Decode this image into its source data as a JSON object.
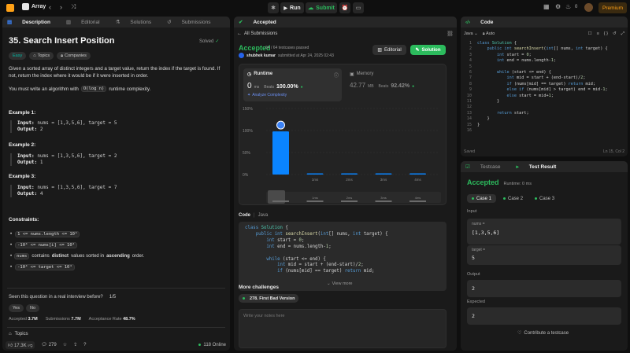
{
  "topbar": {
    "problem_list_label": "Array",
    "run_label": "Run",
    "submit_label": "Submit",
    "premium_label": "Premium",
    "notif_count": "0"
  },
  "left": {
    "tabs": [
      "Description",
      "Editorial",
      "Solutions",
      "Submissions"
    ],
    "title": "35. Search Insert Position",
    "solved_label": "Solved",
    "difficulty": "Easy",
    "topics_label": "Topics",
    "companies_label": "Companies",
    "desc_1": "Given a sorted array of distinct integers and a target value, return the index if the target is found. If not, return the index where it would be if it were inserted in order.",
    "desc_2_a": "You must write an algorithm with",
    "desc_2_code": "O(log n)",
    "desc_2_b": "runtime complexity.",
    "examples": [
      {
        "title": "Example 1:",
        "input": "nums = [1,3,5,6], target = 5",
        "output": "2"
      },
      {
        "title": "Example 2:",
        "input": "nums = [1,3,5,6], target = 2",
        "output": "1"
      },
      {
        "title": "Example 3:",
        "input": "nums = [1,3,5,6], target = 7",
        "output": "4"
      }
    ],
    "input_label": "Input:",
    "output_label": "Output:",
    "constraints_title": "Constraints:",
    "constraints": [
      "1 <= nums.length <= 10⁴",
      "-10⁴ <= nums[i] <= 10⁴",
      "",
      "-10⁴ <= target <= 10⁴"
    ],
    "constraint3_code": "nums",
    "constraint3_a": "contains",
    "constraint3_b": "distinct",
    "constraint3_c": "values sorted in",
    "constraint3_d": "ascending",
    "constraint3_e": "order.",
    "interview_q": "Seen this question in a real interview before?",
    "interview_pages": "1/5",
    "yes": "Yes",
    "no": "No",
    "accepted_label": "Accepted",
    "accepted_val": "3.7M",
    "submissions_label": "Submissions",
    "submissions_val": "7.7M",
    "rate_label": "Acceptance Rate",
    "rate_val": "48.7%",
    "topics_footer": "Topics",
    "likes": "17.3K",
    "comments": "279",
    "online": "118 Online"
  },
  "middle": {
    "tab": "Accepted",
    "all_submissions": "All Submissions",
    "status": "Accepted",
    "testcases": "64 / 64 testcases passed",
    "user": "shubhek kumar",
    "submitted_at": "submitted at Apr 24, 2025 02:43",
    "editorial_btn": "Editorial",
    "solution_btn": "Solution",
    "runtime_label": "Runtime",
    "runtime_val": "0",
    "runtime_unit": "ms",
    "beats_label": "Beats",
    "runtime_beats": "100.00%",
    "analyze": "Analyze Complexity",
    "memory_label": "Memory",
    "memory_val": "42.77",
    "memory_unit": "MB",
    "memory_beats": "92.42%",
    "code_label": "Code",
    "lang": "Java",
    "view_more": "View more",
    "more_challenges": "More challenges",
    "challenge": "278. First Bad Version",
    "notes_placeholder": "Write your notes here"
  },
  "chart_data": {
    "type": "bar",
    "categories": [
      "",
      "1ms",
      "2ms",
      "3ms",
      "4ms"
    ],
    "values": [
      98,
      1.5,
      1,
      0.8,
      0.8
    ],
    "ylim": [
      0,
      150
    ],
    "yticks": [
      "150%",
      "100%",
      "50%",
      "0%"
    ],
    "mini_labels": [
      "",
      "1ms",
      "2ms",
      "3ms",
      "4ms"
    ]
  },
  "right": {
    "code_tab": "Code",
    "lang": "Java",
    "auto": "Auto",
    "saved": "Saved",
    "cursor": "Ln 15, Col 2",
    "testcase_tab": "Testcase",
    "result_tab": "Test Result",
    "status": "Accepted",
    "runtime": "Runtime: 0 ms",
    "cases": [
      "Case 1",
      "Case 2",
      "Case 3"
    ],
    "input_label": "Input",
    "nums_label": "nums =",
    "nums_val": "[1,3,5,6]",
    "target_label": "target =",
    "target_val": "5",
    "output_label": "Output",
    "output_val": "2",
    "expected_label": "Expected",
    "expected_val": "2",
    "contribute": "Contribute a testcase"
  }
}
